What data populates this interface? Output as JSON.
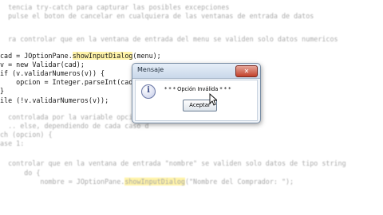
{
  "editor": {
    "lines": [
      {
        "text": "  tencia try-catch para capturar las posibles excepciones",
        "kind": "comment blurred"
      },
      {
        "text": "  pulse el boton de cancelar en cualquiera de las ventanas de entrada de datos",
        "kind": "comment blurred"
      },
      {
        "text": "",
        "kind": ""
      },
      {
        "text": "  ra controlar que en la ventana de entrada del menu se validen solo datos numericos",
        "kind": "comment blurred"
      },
      {
        "text": "",
        "kind": ""
      },
      {
        "pre": "cad = JOptionPane.",
        "method": "showInputDialog",
        "post": "(menu);",
        "kind": "code"
      },
      {
        "text": "v = new Validar(cad);",
        "kind": "code"
      },
      {
        "text": "if (v.validarNumeros(v)) {",
        "kind": "code"
      },
      {
        "text": "    opcion = Integer.parseInt(cad);",
        "kind": "code"
      },
      {
        "text": "}",
        "kind": "code"
      },
      {
        "text": "ile (!v.validarNumeros(v));",
        "kind": "code"
      },
      {
        "text": "",
        "kind": ""
      },
      {
        "text": "  controlada por la variable opcion,",
        "kind": "comment blurred"
      },
      {
        "text": "  .. else, dependiendo de cada caso d",
        "kind": "comment blurred"
      },
      {
        "text": "ch (opcion) {",
        "kind": "code blurred"
      },
      {
        "text": "ase 1:",
        "kind": "code blurred"
      },
      {
        "text": "",
        "kind": ""
      },
      {
        "text": "  controlar que en la ventana de entrada \"nombre\" se validen solo datos de tipo string",
        "kind": "comment blurred"
      },
      {
        "text": "      do {",
        "kind": "code blurred"
      },
      {
        "pre": "          nombre = JOptionPane.",
        "method": "showInputDialog",
        "post": "(\"Nombre del Comprador: \");",
        "kind": "code blurred"
      }
    ]
  },
  "dialog": {
    "title": "Mensaje",
    "close_glyph": "✕",
    "icon": "info-icon",
    "icon_glyph": "i",
    "message": "* * * Opción Inválida * * *",
    "ok_label": "Aceptar"
  }
}
